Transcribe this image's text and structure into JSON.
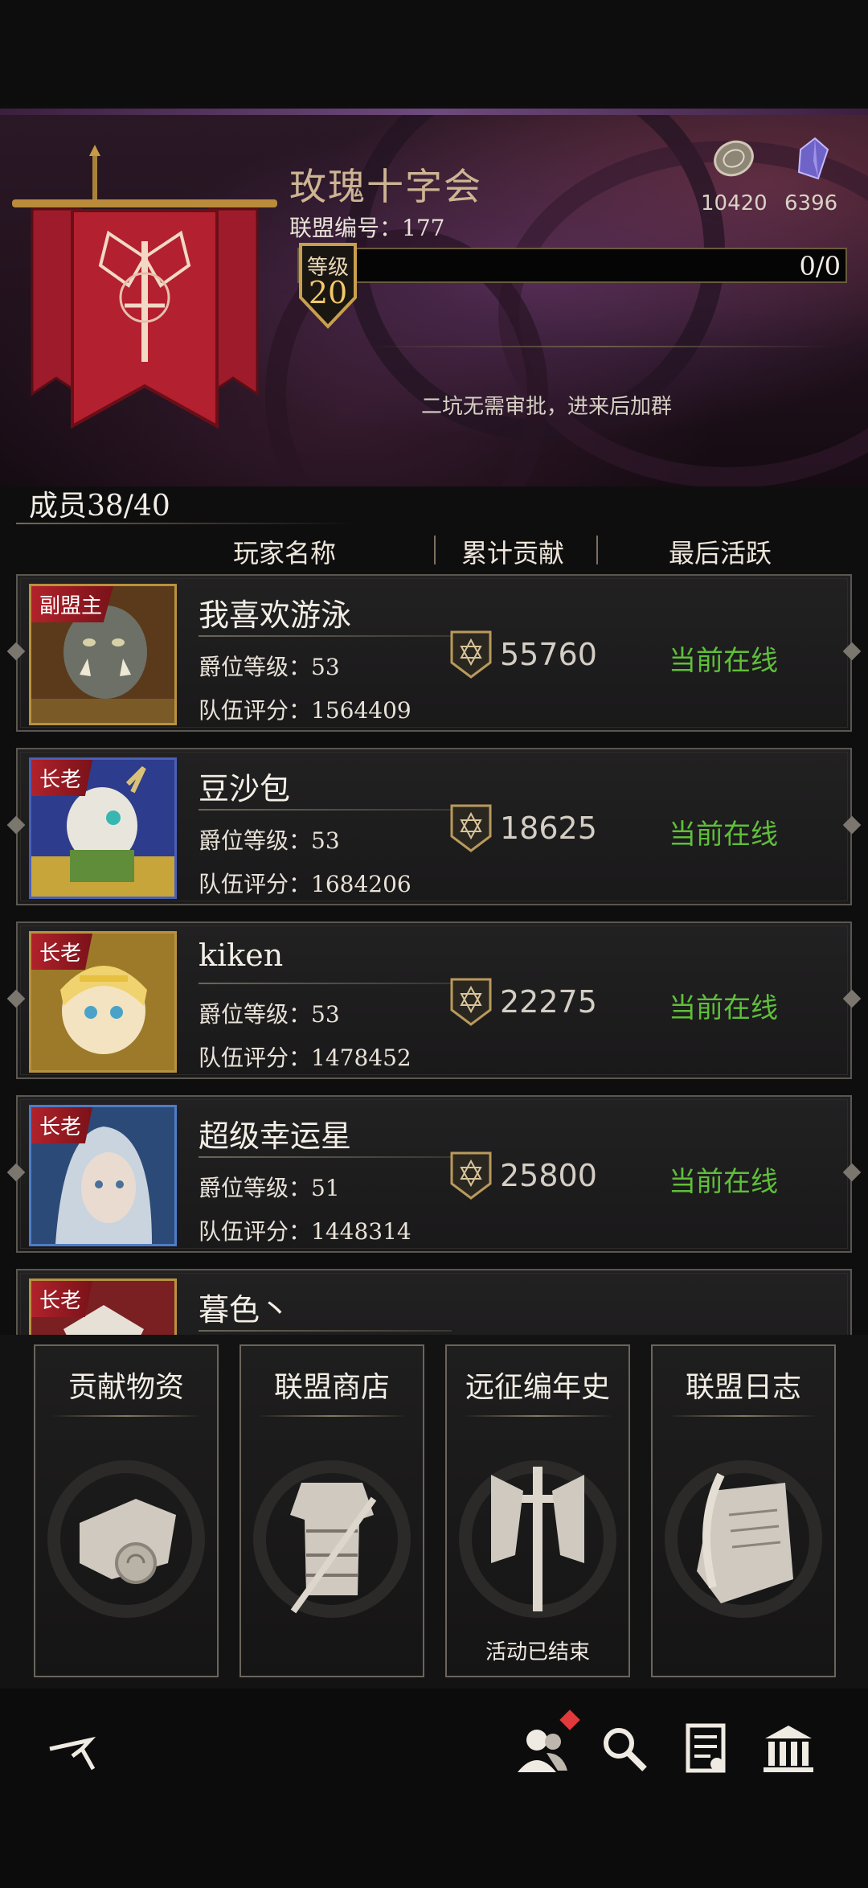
{
  "alliance": {
    "name": "玫瑰十字会",
    "id_label": "联盟编号：177",
    "level_label": "等级",
    "level": "20",
    "progress": "0/0",
    "notice": "二坑无需审批，进来后加群"
  },
  "currencies": [
    {
      "icon": "coin-icon",
      "value": "10420"
    },
    {
      "icon": "crystal-icon",
      "value": "6396"
    }
  ],
  "members_count": "成员38/40",
  "columns": {
    "name": "玩家名称",
    "contribution": "累计贡献",
    "last_active": "最后活跃"
  },
  "members": [
    {
      "role": "副盟主",
      "name": "我喜欢游泳",
      "rank": "爵位等级：53",
      "score": "队伍评分：1564409",
      "contribution": "55760",
      "status": "当前在线",
      "avatar": "orc-warrior"
    },
    {
      "role": "长老",
      "name": "豆沙包",
      "rank": "爵位等级：53",
      "score": "队伍评分：1684206",
      "contribution": "18625",
      "status": "当前在线",
      "avatar": "white-deer"
    },
    {
      "role": "长老",
      "name": "kiken",
      "rank": "爵位等级：53",
      "score": "队伍评分：1478452",
      "contribution": "22275",
      "status": "当前在线",
      "avatar": "blonde-elf"
    },
    {
      "role": "长老",
      "name": "超级幸运星",
      "rank": "爵位等级：51",
      "score": "队伍评分：1448314",
      "contribution": "25800",
      "status": "当前在线",
      "avatar": "silver-hair-woman"
    },
    {
      "role": "长老",
      "name": "暮色丶",
      "rank": "",
      "score": "",
      "contribution": "",
      "status": "",
      "avatar": "crest"
    }
  ],
  "features": [
    {
      "title": "贡献物资",
      "icon": "scroll-map-icon",
      "subtitle": ""
    },
    {
      "title": "联盟商店",
      "icon": "armor-sword-icon",
      "subtitle": ""
    },
    {
      "title": "远征编年史",
      "icon": "crossed-banners-sword-icon",
      "subtitle": "活动已结束"
    },
    {
      "title": "联盟日志",
      "icon": "quill-parchment-icon",
      "subtitle": ""
    }
  ],
  "bottom_nav": [
    "back-icon",
    "members-icon",
    "search-icon",
    "document-icon",
    "hall-icon"
  ]
}
